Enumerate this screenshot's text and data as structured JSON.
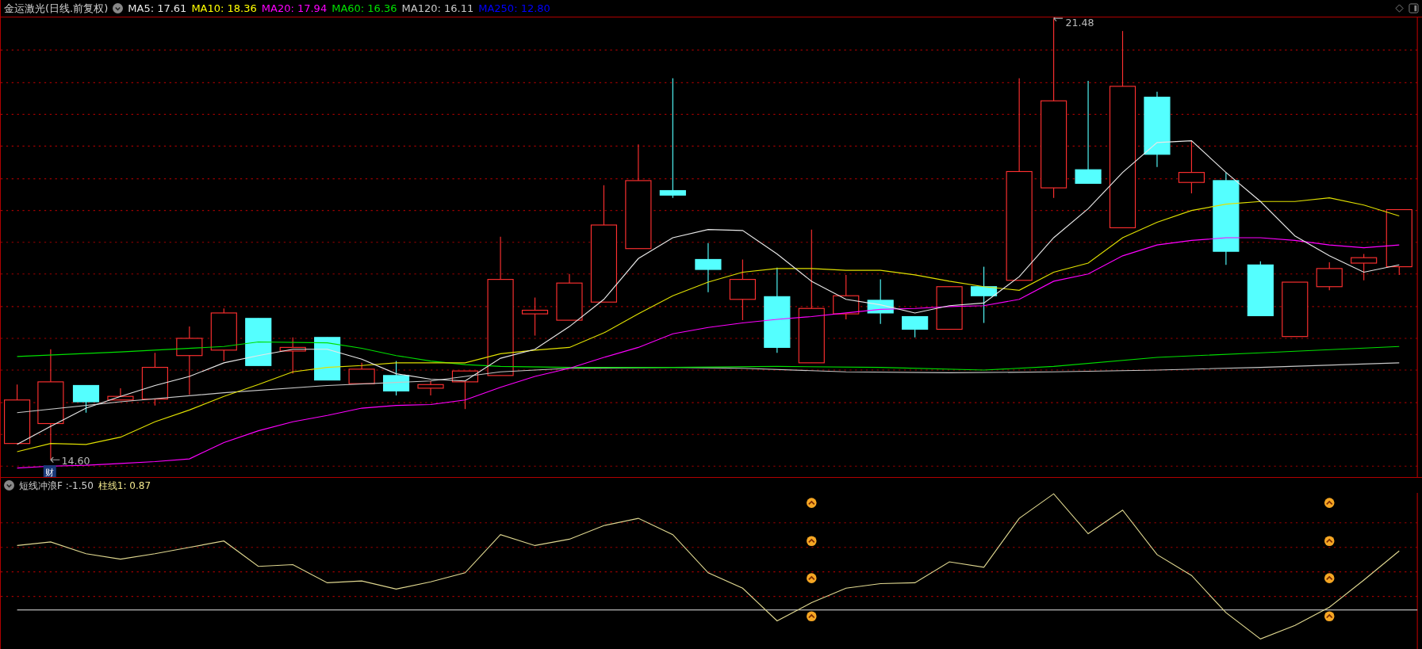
{
  "main_chart": {
    "title": "金运激光(日线.前复权)",
    "indicators": [
      {
        "label": "MA5: 17.61",
        "color": "#e8e8e8"
      },
      {
        "label": "MA10: 18.36",
        "color": "#ffff00"
      },
      {
        "label": "MA20: 17.94",
        "color": "#ff00ff"
      },
      {
        "label": "MA60: 16.36",
        "color": "#00e000"
      },
      {
        "label": "MA120: 16.11",
        "color": "#c8c8c8"
      },
      {
        "label": "MA250: 12.80",
        "color": "#0000ff"
      }
    ],
    "high_label": "21.48",
    "low_label": "14.60",
    "badge": "财"
  },
  "sub_chart": {
    "name": "短线冲浪F",
    "value": ":-1.50",
    "indicators": [
      {
        "label": "柱线1: 0.87",
        "color": "#f0e68c"
      }
    ]
  }
}
